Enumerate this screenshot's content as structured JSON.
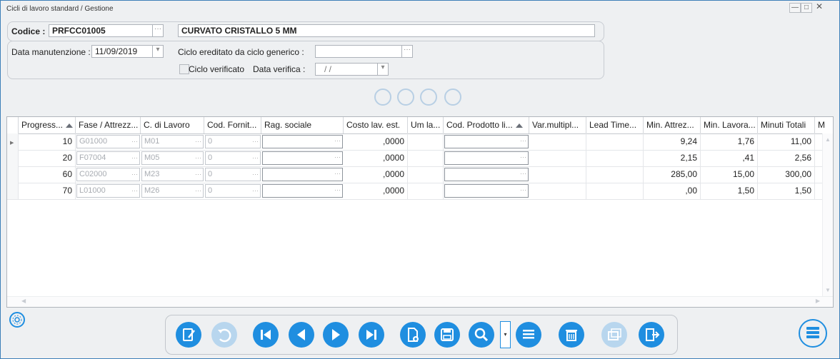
{
  "window": {
    "title": "Cicli di lavoro standard / Gestione",
    "minimize": "—",
    "maximize": "□",
    "close": "✕"
  },
  "header": {
    "codice_label": "Codice :",
    "codice_value": "PRFCC01005",
    "description": "CURVATO CRISTALLO 5 MM",
    "data_manutenzione_label": "Data manutenzione :",
    "data_manutenzione_value": "11/09/2019",
    "ciclo_ereditato_label": "Ciclo ereditato da ciclo generico :",
    "ciclo_ereditato_value": "",
    "ciclo_verificato_label": "Ciclo verificato",
    "data_verifica_label": "Data verifica :",
    "data_verifica_value": "/ /"
  },
  "grid": {
    "columns": [
      "Progress...",
      "Fase / Attrezz...",
      "C. di Lavoro",
      "Cod. Fornit...",
      "Rag. sociale",
      "Costo lav. est.",
      "Um la...",
      "Cod. Prodotto li...",
      "Var.multipl...",
      "Lead Time...",
      "Min. Attrez...",
      "Min. Lavora...",
      "Minuti Totali",
      "M"
    ],
    "rows": [
      {
        "progress": "10",
        "fase": "G01000",
        "centro": "M01",
        "fornitore": "0",
        "rag": "",
        "costo": ",0000",
        "um": "",
        "prodotto": "",
        "var": "",
        "lead": "",
        "min_attrez": "9,24",
        "min_lav": "1,76",
        "min_tot": "11,00"
      },
      {
        "progress": "20",
        "fase": "F07004",
        "centro": "M05",
        "fornitore": "0",
        "rag": "",
        "costo": ",0000",
        "um": "",
        "prodotto": "",
        "var": "",
        "lead": "",
        "min_attrez": "2,15",
        "min_lav": ",41",
        "min_tot": "2,56"
      },
      {
        "progress": "60",
        "fase": "C02000",
        "centro": "M23",
        "fornitore": "0",
        "rag": "",
        "costo": ",0000",
        "um": "",
        "prodotto": "",
        "var": "",
        "lead": "",
        "min_attrez": "285,00",
        "min_lav": "15,00",
        "min_tot": "300,00"
      },
      {
        "progress": "70",
        "fase": "L01000",
        "centro": "M26",
        "fornitore": "0",
        "rag": "",
        "costo": ",0000",
        "um": "",
        "prodotto": "",
        "var": "",
        "lead": "",
        "min_attrez": ",00",
        "min_lav": "1,50",
        "min_tot": "1,50"
      }
    ]
  },
  "toolbar": {
    "buttons": [
      "edit-icon",
      "undo-icon",
      "first-record-icon",
      "previous-record-icon",
      "next-record-icon",
      "last-record-icon",
      "new-document-icon",
      "save-icon",
      "search-icon",
      "list-icon",
      "delete-icon",
      "copy-icon",
      "exit-icon"
    ],
    "accent": "#1f8ee0",
    "disabled_color": "#b8d6ee"
  }
}
